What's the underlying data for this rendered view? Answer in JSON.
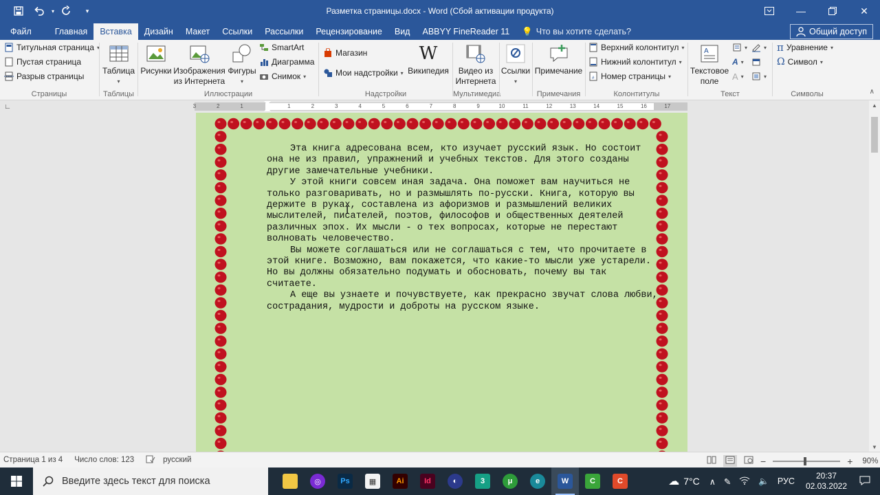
{
  "window": {
    "title": "Разметка страницы.docx - Word (Сбой активации продукта)"
  },
  "quick_access": {
    "save_icon": "save-icon",
    "undo_icon": "undo-icon",
    "redo_icon": "redo-icon"
  },
  "tabs": [
    {
      "label": "Файл",
      "active": false
    },
    {
      "label": "Главная",
      "active": false
    },
    {
      "label": "Вставка",
      "active": true
    },
    {
      "label": "Дизайн",
      "active": false
    },
    {
      "label": "Макет",
      "active": false
    },
    {
      "label": "Ссылки",
      "active": false
    },
    {
      "label": "Рассылки",
      "active": false
    },
    {
      "label": "Рецензирование",
      "active": false
    },
    {
      "label": "Вид",
      "active": false
    },
    {
      "label": "ABBYY FineReader 11",
      "active": false
    }
  ],
  "tell_me": "Что вы хотите сделать?",
  "share_label": "Общий доступ",
  "ribbon": {
    "pages": {
      "label": "Страницы",
      "title_page": "Титульная страница",
      "blank_page": "Пустая страница",
      "page_break": "Разрыв страницы"
    },
    "tables": {
      "label": "Таблицы",
      "table": "Таблица"
    },
    "illustrations": {
      "label": "Иллюстрации",
      "pictures": "Рисунки",
      "online_pictures_1": "Изображения",
      "online_pictures_2": "из Интернета",
      "shapes": "Фигуры",
      "smartart": "SmartArt",
      "chart": "Диаграмма",
      "screenshot": "Снимок"
    },
    "addins": {
      "label": "Надстройки",
      "store": "Магазин",
      "my_addins": "Мои надстройки",
      "wikipedia": "Википедия"
    },
    "media": {
      "label": "Мультимедиа",
      "online_video_1": "Видео из",
      "online_video_2": "Интернета"
    },
    "links": {
      "label": "",
      "links": "Ссылки"
    },
    "comments": {
      "label": "Примечания",
      "comment": "Примечание"
    },
    "header_footer": {
      "label": "Колонтитулы",
      "header": "Верхний колонтитул",
      "footer": "Нижний колонтитул",
      "page_number": "Номер страницы"
    },
    "text": {
      "label": "Текст",
      "textbox_1": "Текстовое",
      "textbox_2": "поле"
    },
    "symbols": {
      "label": "Символы",
      "equation": "Уравнение",
      "symbol": "Символ"
    }
  },
  "ruler": {
    "ticks": [
      "3",
      "2",
      "1",
      "1",
      "2",
      "3",
      "4",
      "5",
      "6",
      "7",
      "8",
      "9",
      "10",
      "11",
      "12",
      "13",
      "14",
      "15",
      "16",
      "17"
    ]
  },
  "document": {
    "paragraphs": [
      "Эта книга адресована всем, кто изучает русский язык. Но состоит она не из правил, упражнений и учебных текстов. Для этого созданы другие замечательные учебники.",
      "У этой книги совсем иная задача. Она поможет вам научиться не только разговаривать, но и размышлять по-русски. Книга, которую вы держите в руках, составлена из афоризмов и размышлений великих мыслителей, писателей, поэтов, философов и общественных деятелей различных эпох. Их мысли - о тех вопросах, которые не перестают волновать человечество.",
      "Вы можете соглашаться или не соглашаться с тем, что прочитаете в этой книге. Возможно, вам покажется, что какие-то мысли уже устарели. Но вы должны обязательно подумать и обосновать, почему вы так считаете.",
      "А еще вы узнаете и почувствуете, как прекрасно звучат слова любви, сострадания, мудрости и доброты на русском языке."
    ],
    "page_color": "#c5e1a5",
    "border_color": "#c0111f"
  },
  "statusbar": {
    "page": "Страница 1 из 4",
    "words": "Число слов: 123",
    "language": "русский",
    "zoom": "90%"
  },
  "taskbar": {
    "search_placeholder": "Введите здесь текст для поиска",
    "temperature": "7°C",
    "lang": "РУС",
    "time": "20:37",
    "date": "02.03.2022"
  }
}
